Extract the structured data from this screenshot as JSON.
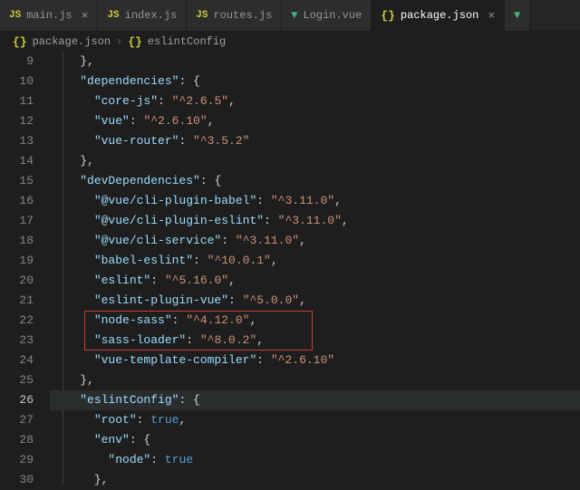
{
  "tabs": [
    {
      "icon": "JS",
      "iconClass": "js-icon",
      "label": "main.js",
      "close": true
    },
    {
      "icon": "JS",
      "iconClass": "js-icon",
      "label": "index.js"
    },
    {
      "icon": "JS",
      "iconClass": "js-icon",
      "label": "routes.js"
    },
    {
      "icon": "▼",
      "iconClass": "vue-icon",
      "label": "Login.vue"
    },
    {
      "icon": "{}",
      "iconClass": "json-icon",
      "label": "package.json",
      "active": true,
      "close": true
    },
    {
      "icon": "▼",
      "iconClass": "vue-icon",
      "label": ""
    }
  ],
  "breadcrumbs": {
    "icon1": "{}",
    "file": "package.json",
    "sep": "›",
    "icon2": "{}",
    "symbol": "eslintConfig"
  },
  "lines": {
    "start": 9,
    "current": 26,
    "l9": {
      "ind": 1,
      "tokens": [
        [
          "p",
          "    },"
        ]
      ]
    },
    "l10": {
      "ind": 1,
      "tokens": [
        [
          "p",
          "    "
        ],
        [
          "k",
          "\"dependencies\""
        ],
        [
          "p",
          ": {"
        ]
      ]
    },
    "l11": {
      "ind": 2,
      "tokens": [
        [
          "p",
          "      "
        ],
        [
          "k",
          "\"core-js\""
        ],
        [
          "p",
          ": "
        ],
        [
          "s",
          "\"^2.6.5\""
        ],
        [
          "p",
          ","
        ]
      ]
    },
    "l12": {
      "ind": 2,
      "tokens": [
        [
          "p",
          "      "
        ],
        [
          "k",
          "\"vue\""
        ],
        [
          "p",
          ": "
        ],
        [
          "s",
          "\"^2.6.10\""
        ],
        [
          "p",
          ","
        ]
      ]
    },
    "l13": {
      "ind": 2,
      "tokens": [
        [
          "p",
          "      "
        ],
        [
          "k",
          "\"vue-router\""
        ],
        [
          "p",
          ": "
        ],
        [
          "s",
          "\"^3.5.2\""
        ]
      ]
    },
    "l14": {
      "ind": 1,
      "tokens": [
        [
          "p",
          "    },"
        ]
      ]
    },
    "l15": {
      "ind": 1,
      "tokens": [
        [
          "p",
          "    "
        ],
        [
          "k",
          "\"devDependencies\""
        ],
        [
          "p",
          ": {"
        ]
      ]
    },
    "l16": {
      "ind": 2,
      "tokens": [
        [
          "p",
          "      "
        ],
        [
          "k",
          "\"@vue/cli-plugin-babel\""
        ],
        [
          "p",
          ": "
        ],
        [
          "s",
          "\"^3.11.0\""
        ],
        [
          "p",
          ","
        ]
      ]
    },
    "l17": {
      "ind": 2,
      "tokens": [
        [
          "p",
          "      "
        ],
        [
          "k",
          "\"@vue/cli-plugin-eslint\""
        ],
        [
          "p",
          ": "
        ],
        [
          "s",
          "\"^3.11.0\""
        ],
        [
          "p",
          ","
        ]
      ]
    },
    "l18": {
      "ind": 2,
      "tokens": [
        [
          "p",
          "      "
        ],
        [
          "k",
          "\"@vue/cli-service\""
        ],
        [
          "p",
          ": "
        ],
        [
          "s",
          "\"^3.11.0\""
        ],
        [
          "p",
          ","
        ]
      ]
    },
    "l19": {
      "ind": 2,
      "tokens": [
        [
          "p",
          "      "
        ],
        [
          "k",
          "\"babel-eslint\""
        ],
        [
          "p",
          ": "
        ],
        [
          "s",
          "\"^10.0.1\""
        ],
        [
          "p",
          ","
        ]
      ]
    },
    "l20": {
      "ind": 2,
      "tokens": [
        [
          "p",
          "      "
        ],
        [
          "k",
          "\"eslint\""
        ],
        [
          "p",
          ": "
        ],
        [
          "s",
          "\"^5.16.0\""
        ],
        [
          "p",
          ","
        ]
      ]
    },
    "l21": {
      "ind": 2,
      "tokens": [
        [
          "p",
          "      "
        ],
        [
          "k",
          "\"eslint-plugin-vue\""
        ],
        [
          "p",
          ": "
        ],
        [
          "s",
          "\"^5.0.0\""
        ],
        [
          "p",
          ","
        ]
      ]
    },
    "l22": {
      "ind": 2,
      "tokens": [
        [
          "p",
          "      "
        ],
        [
          "k",
          "\"node-sass\""
        ],
        [
          "p",
          ": "
        ],
        [
          "s",
          "\"^4.12.0\""
        ],
        [
          "p",
          ","
        ]
      ]
    },
    "l23": {
      "ind": 2,
      "tokens": [
        [
          "p",
          "      "
        ],
        [
          "k",
          "\"sass-loader\""
        ],
        [
          "p",
          ": "
        ],
        [
          "s",
          "\"^8.0.2\""
        ],
        [
          "p",
          ","
        ]
      ]
    },
    "l24": {
      "ind": 2,
      "tokens": [
        [
          "p",
          "      "
        ],
        [
          "k",
          "\"vue-template-compiler\""
        ],
        [
          "p",
          ": "
        ],
        [
          "s",
          "\"^2.6.10\""
        ]
      ]
    },
    "l25": {
      "ind": 1,
      "tokens": [
        [
          "p",
          "    },"
        ]
      ]
    },
    "l26": {
      "ind": 1,
      "tokens": [
        [
          "p",
          "    "
        ],
        [
          "k",
          "\"eslintConfig\""
        ],
        [
          "p",
          ": {"
        ]
      ]
    },
    "l27": {
      "ind": 2,
      "tokens": [
        [
          "p",
          "      "
        ],
        [
          "k",
          "\"root\""
        ],
        [
          "p",
          ": "
        ],
        [
          "b",
          "true"
        ],
        [
          "p",
          ","
        ]
      ]
    },
    "l28": {
      "ind": 2,
      "tokens": [
        [
          "p",
          "      "
        ],
        [
          "k",
          "\"env\""
        ],
        [
          "p",
          ": {"
        ]
      ]
    },
    "l29": {
      "ind": 3,
      "tokens": [
        [
          "p",
          "        "
        ],
        [
          "k",
          "\"node\""
        ],
        [
          "p",
          ": "
        ],
        [
          "b",
          "true"
        ]
      ]
    },
    "l30": {
      "ind": 2,
      "tokens": [
        [
          "p",
          "      },"
        ]
      ]
    }
  },
  "highlight_box": {
    "top_line": 22,
    "bottom_line": 23
  }
}
